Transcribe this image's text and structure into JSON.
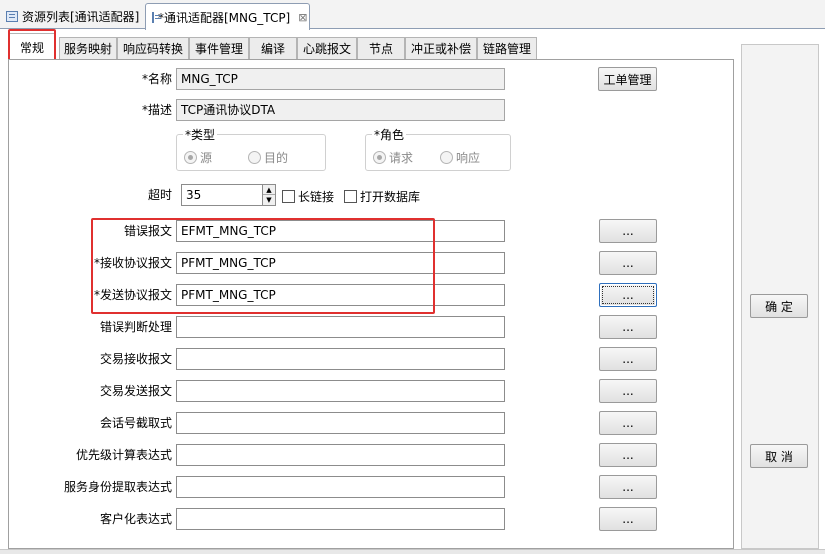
{
  "editor_tabs": [
    {
      "label": "资源列表[通讯适配器]",
      "icon": "list-icon"
    },
    {
      "label": "*通讯适配器[MNG_TCP]",
      "icon": "adapter-icon",
      "close": "⊠"
    }
  ],
  "page_tabs": [
    "常规",
    "服务映射",
    "响应码转换",
    "事件管理",
    "编译",
    "心跳报文",
    "节点",
    "冲正或补偿",
    "链路管理"
  ],
  "active_page_tab": "常规",
  "form": {
    "name_label": "*名称",
    "name_value": "MNG_TCP",
    "desc_label": "*描述",
    "desc_value": "TCP通讯协议DTA",
    "ticket_button": "工单管理",
    "type_group": {
      "title": "*类型",
      "options": [
        "源",
        "目的"
      ],
      "selected": "源"
    },
    "role_group": {
      "title": "*角色",
      "options": [
        "请求",
        "响应"
      ],
      "selected": "请求"
    },
    "timeout_label": "超时",
    "timeout_value": "35",
    "long_link_label": "长链接",
    "open_db_label": "打开数据库",
    "rows": [
      {
        "label": "错误报文",
        "value": "EFMT_MNG_TCP",
        "button": "..."
      },
      {
        "label": "*接收协议报文",
        "value": "PFMT_MNG_TCP",
        "button": "..."
      },
      {
        "label": "*发送协议报文",
        "value": "PFMT_MNG_TCP",
        "button": "..."
      },
      {
        "label": "错误判断处理",
        "value": "",
        "button": "..."
      },
      {
        "label": "交易接收报文",
        "value": "",
        "button": "..."
      },
      {
        "label": "交易发送报文",
        "value": "",
        "button": "..."
      },
      {
        "label": "会话号截取式",
        "value": "",
        "button": "..."
      },
      {
        "label": "优先级计算表达式",
        "value": "",
        "button": "..."
      },
      {
        "label": "服务身份提取表达式",
        "value": "",
        "button": "..."
      },
      {
        "label": "客户化表达式",
        "value": "",
        "button": "..."
      }
    ]
  },
  "side_buttons": {
    "confirm": "确 定",
    "cancel": "取 消"
  },
  "colors": {
    "highlight_red": "#e0302f",
    "focus_blue": "#2e6fbd"
  }
}
